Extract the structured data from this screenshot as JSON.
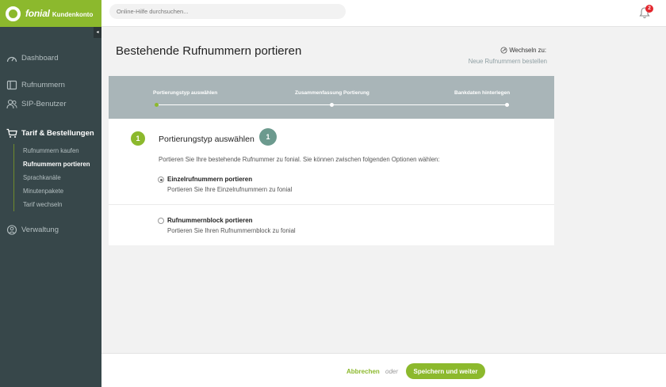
{
  "header": {
    "brand": "fonial",
    "brand_sub": "Kundenkonto",
    "search_placeholder": "Online-Hilfe durchsuchen...",
    "notification_count": "2"
  },
  "sidebar": {
    "items": [
      {
        "label": "Dashboard",
        "icon": "dashboard-icon"
      },
      {
        "label": "Rufnummern",
        "icon": "numbers-icon"
      },
      {
        "label": "SIP-Benutzer",
        "icon": "users-icon"
      },
      {
        "label": "Tarif & Bestellungen",
        "icon": "cart-icon"
      },
      {
        "label": "Verwaltung",
        "icon": "admin-icon"
      }
    ],
    "subitems": [
      "Rufnummern kaufen",
      "Rufnummern portieren",
      "Sprachkanäle",
      "Minutenpakete",
      "Tarif wechseln"
    ],
    "collapse_glyph": "◂"
  },
  "main": {
    "title": "Bestehende Rufnummern portieren",
    "switch_label": "Wechseln zu:",
    "switch_link": "Neue Rufnummern bestellen",
    "steps": [
      "Portierungstyp auswählen",
      "Zusammenfassung Portierung",
      "Bankdaten hinterlegen"
    ],
    "step_number": "1",
    "step_heading": "Portierungstyp auswählen",
    "step_bubble": "1",
    "intro": "Portieren Sie Ihre bestehende Rufnummer zu fonial. Sie können zwischen folgenden Optionen wählen:",
    "options": [
      {
        "title": "Einzelrufnummern portieren",
        "desc": "Portieren Sie Ihre Einzelrufnummern zu fonial",
        "checked": true
      },
      {
        "title": "Rufnummernblock portieren",
        "desc": "Portieren Sie Ihren Rufnummernblock zu fonial",
        "checked": false
      }
    ]
  },
  "footer": {
    "cancel": "Abbrechen",
    "or": "oder",
    "save": "Speichern und weiter"
  },
  "colors": {
    "accent": "#8cb92d",
    "sidebar": "#37474a",
    "stepper": "#a9b5b8",
    "badge": "#e3262d"
  }
}
